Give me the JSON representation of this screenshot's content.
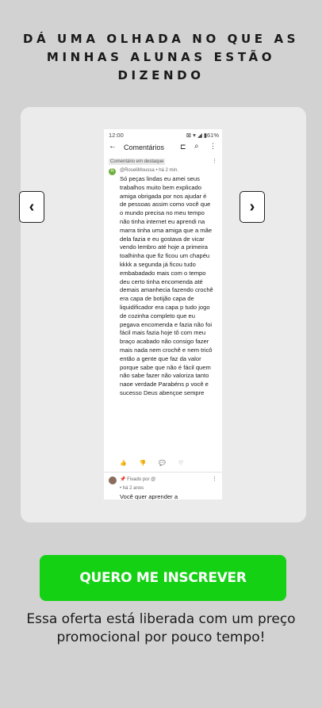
{
  "heading": "DÁ UMA OLHADA NO QUE AS MINHAS ALUNAS ESTÃO DIZENDO",
  "carousel": {
    "prev_icon": "chevron-left-icon",
    "next_icon": "chevron-right-icon",
    "prev_glyph": "‹",
    "next_glyph": "›"
  },
  "screenshot": {
    "status_time": "12:00",
    "status_icons": "⊠ ▾ ◢ ▮61%",
    "back_glyph": "←",
    "title": "Comentários",
    "cast_glyph": "⊏",
    "search_glyph": "⌕",
    "more_glyph": "⋮",
    "featured_label": "Comentário em destaque",
    "avatar_letter": "R",
    "author": "@RoseliMoussa • há 2 min.",
    "comment": "Só peças lindas eu amei seus trabalhos muito bem explicado amiga obrigada por nos ajudar é de pessoas assim como você que o mundo precisa no meu tempo não tinha internet eu aprendi na marra tinha uma amiga que a mãe dela fazia e eu gostava de vicar vendo lembro até hoje a primeira toalhinha que fiz ficou um chapéu kkkk a segunda já ficou tudo embabadado mais com o tempo deu certo tinha encomenda até demais amanhecia fazendo crochê era capa de botijão capa de liquidificador era capa p tudo jogo de cozinha completo que eu pegava encomenda e fazia não foi fácil mais fazia hoje tô com meu braço acabado não consigo fazer mais nada nem crochê e nem tricô então a gente que faz da valor porque sabe que não é fácil quem não sabe fazer não valoriza tanto naoe verdade Parabéns p você e sucesso Deus abençoe sempre",
    "actions": [
      "👍",
      "👎",
      "💬",
      "♡"
    ],
    "pinned_label": "📌 Fixado por @",
    "reply_author": "• há 2 anos",
    "reply_text": "Você quer aprender a"
  },
  "cta": {
    "label": "QUERO ME INSCREVER"
  },
  "subtext": "Essa oferta está liberada com um preço promocional por pouco tempo!"
}
